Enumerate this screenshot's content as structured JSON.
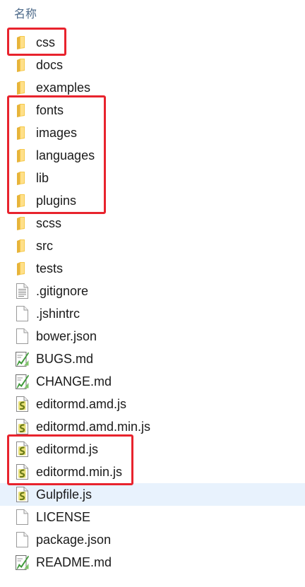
{
  "header": {
    "column_name": "名称",
    "sort_indicator": "^"
  },
  "files": [
    {
      "name": "css",
      "icon": "folder-icon"
    },
    {
      "name": "docs",
      "icon": "folder-icon"
    },
    {
      "name": "examples",
      "icon": "folder-icon"
    },
    {
      "name": "fonts",
      "icon": "folder-icon"
    },
    {
      "name": "images",
      "icon": "folder-icon"
    },
    {
      "name": "languages",
      "icon": "folder-icon"
    },
    {
      "name": "lib",
      "icon": "folder-icon"
    },
    {
      "name": "plugins",
      "icon": "folder-icon"
    },
    {
      "name": "scss",
      "icon": "folder-icon"
    },
    {
      "name": "src",
      "icon": "folder-icon"
    },
    {
      "name": "tests",
      "icon": "folder-icon"
    },
    {
      "name": ".gitignore",
      "icon": "text-file-icon"
    },
    {
      "name": ".jshintrc",
      "icon": "blank-file-icon"
    },
    {
      "name": "bower.json",
      "icon": "blank-file-icon"
    },
    {
      "name": "BUGS.md",
      "icon": "markdown-file-icon"
    },
    {
      "name": "CHANGE.md",
      "icon": "markdown-file-icon"
    },
    {
      "name": "editormd.amd.js",
      "icon": "js-file-icon"
    },
    {
      "name": "editormd.amd.min.js",
      "icon": "js-file-icon"
    },
    {
      "name": "editormd.js",
      "icon": "js-file-icon"
    },
    {
      "name": "editormd.min.js",
      "icon": "js-file-icon"
    },
    {
      "name": "Gulpfile.js",
      "icon": "js-file-icon",
      "selected": true
    },
    {
      "name": "LICENSE",
      "icon": "blank-file-icon"
    },
    {
      "name": "package.json",
      "icon": "blank-file-icon"
    },
    {
      "name": "README.md",
      "icon": "markdown-file-icon"
    }
  ],
  "highlight_groups": [
    [
      "css"
    ],
    [
      "fonts",
      "images",
      "languages",
      "lib",
      "plugins"
    ],
    [
      "editormd.js",
      "editormd.min.js"
    ]
  ],
  "colors": {
    "highlight": "#e8232d",
    "selected_row": "#e8f2fd",
    "header_text": "#4d6a8a"
  }
}
